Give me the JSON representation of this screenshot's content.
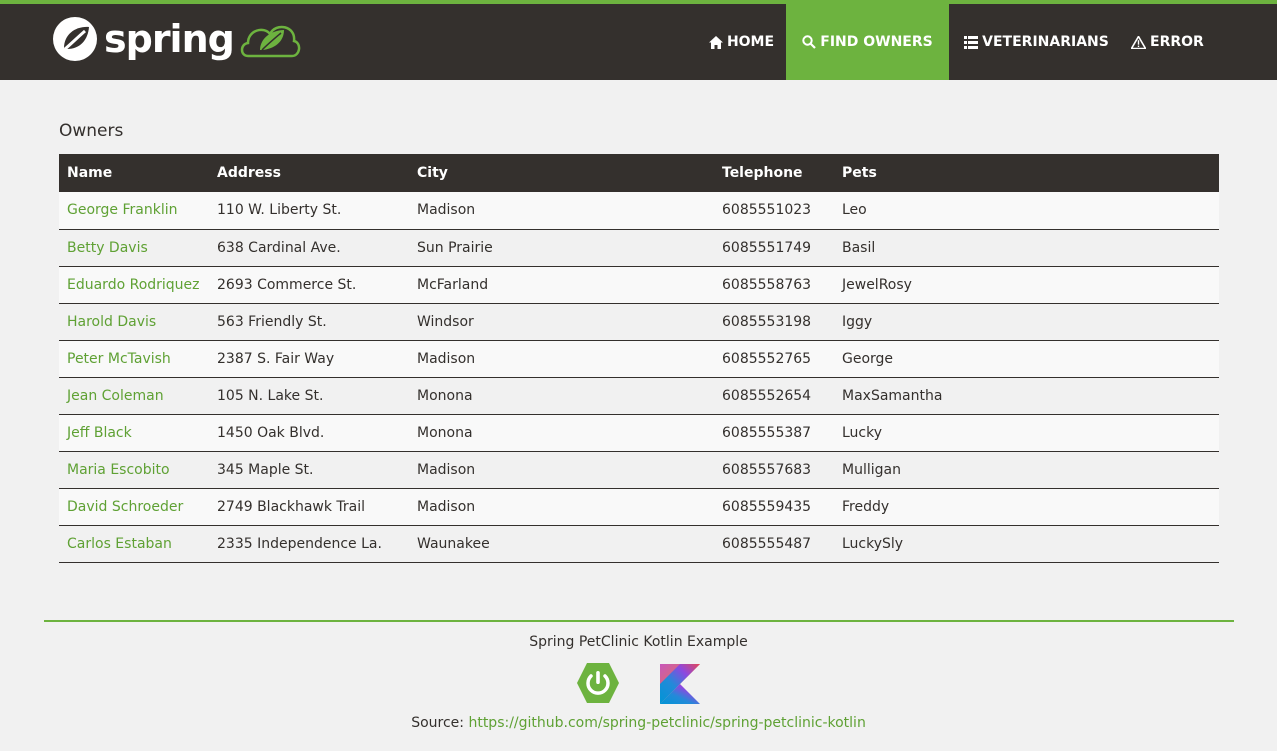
{
  "nav": {
    "brand": "spring",
    "items": [
      {
        "label": "HOME",
        "icon": "home-icon"
      },
      {
        "label": "FIND OWNERS",
        "icon": "search-icon"
      },
      {
        "label": "VETERINARIANS",
        "icon": "list-icon"
      },
      {
        "label": "ERROR",
        "icon": "warning-icon"
      }
    ],
    "active_item": "FIND OWNERS"
  },
  "page": {
    "title": "Owners"
  },
  "table": {
    "headers": [
      "Name",
      "Address",
      "City",
      "Telephone",
      "Pets"
    ],
    "rows": [
      {
        "name": "George Franklin",
        "address": "110 W. Liberty St.",
        "city": "Madison",
        "telephone": "6085551023",
        "pets": "Leo"
      },
      {
        "name": "Betty Davis",
        "address": "638 Cardinal Ave.",
        "city": "Sun Prairie",
        "telephone": "6085551749",
        "pets": "Basil"
      },
      {
        "name": "Eduardo Rodriquez",
        "address": "2693 Commerce St.",
        "city": "McFarland",
        "telephone": "6085558763",
        "pets": "JewelRosy"
      },
      {
        "name": "Harold Davis",
        "address": "563 Friendly St.",
        "city": "Windsor",
        "telephone": "6085553198",
        "pets": "Iggy"
      },
      {
        "name": "Peter McTavish",
        "address": "2387 S. Fair Way",
        "city": "Madison",
        "telephone": "6085552765",
        "pets": "George"
      },
      {
        "name": "Jean Coleman",
        "address": "105 N. Lake St.",
        "city": "Monona",
        "telephone": "6085552654",
        "pets": "MaxSamantha"
      },
      {
        "name": "Jeff Black",
        "address": "1450 Oak Blvd.",
        "city": "Monona",
        "telephone": "6085555387",
        "pets": "Lucky"
      },
      {
        "name": "Maria Escobito",
        "address": "345 Maple St.",
        "city": "Madison",
        "telephone": "6085557683",
        "pets": "Mulligan"
      },
      {
        "name": "David Schroeder",
        "address": "2749 Blackhawk Trail",
        "city": "Madison",
        "telephone": "6085559435",
        "pets": "Freddy"
      },
      {
        "name": "Carlos Estaban",
        "address": "2335 Independence La.",
        "city": "Waunakee",
        "telephone": "6085555487",
        "pets": "LuckySly"
      }
    ]
  },
  "footer": {
    "title": "Spring PetClinic Kotlin Example",
    "logos": [
      "spring-boot-logo",
      "kotlin-logo"
    ],
    "source_label": "Source: ",
    "source_link": "https://github.com/spring-petclinic/spring-petclinic-kotlin"
  },
  "colors": {
    "brand_green": "#6db33f",
    "dark": "#34302d",
    "background": "#f1f1f1",
    "link": "#5fa134"
  }
}
